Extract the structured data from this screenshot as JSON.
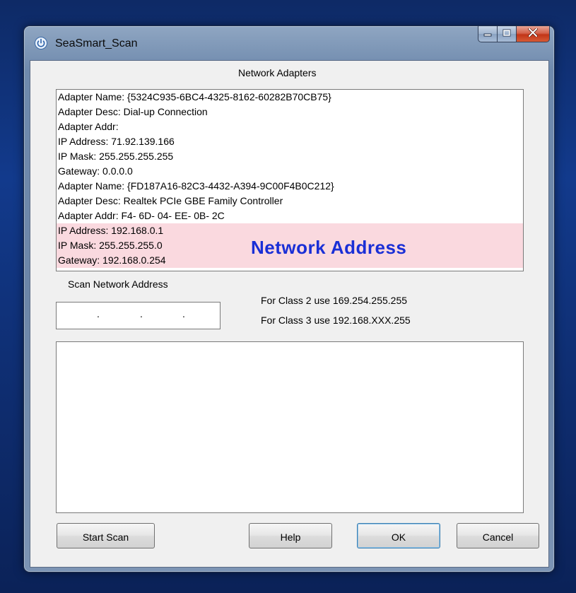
{
  "window": {
    "title": "SeaSmart_Scan",
    "icon": "power-icon"
  },
  "caption_buttons": [
    "minimize-icon",
    "maximize-icon",
    "close-icon"
  ],
  "adapters": {
    "heading": "Network Adapters",
    "lines": [
      "Adapter Name: {5324C935-6BC4-4325-8162-60282B70CB75}",
      "Adapter Desc: Dial-up Connection",
      "Adapter Addr:",
      "IP Address: 71.92.139.166",
      "IP Mask: 255.255.255.255",
      "Gateway: 0.0.0.0",
      "Adapter Name: {FD187A16-82C3-4432-A394-9C00F4B0C212}",
      "Adapter Desc: Realtek PCIe GBE Family Controller",
      "Adapter Addr:  F4- 6D- 04- EE- 0B- 2C",
      "IP Address: 192.168.0.1",
      "IP Mask: 255.255.255.0",
      "Gateway: 192.168.0.254"
    ],
    "highlight_overlay": "Network Address",
    "highlight_color": "#fad9df",
    "overlay_color": "#1a2fd6"
  },
  "scan": {
    "label": "Scan Network Address",
    "ip_dots": [
      ".",
      ".",
      "."
    ],
    "hint_class2": "For Class 2 use 169.254.255.255",
    "hint_class3": "For Class 3 use 192.168.XXX.255"
  },
  "buttons": {
    "start_scan": "Start Scan",
    "help": "Help",
    "ok": "OK",
    "cancel": "Cancel"
  }
}
